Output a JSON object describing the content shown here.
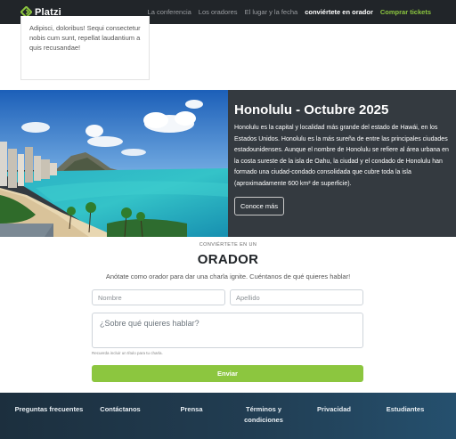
{
  "navbar": {
    "brand": "Platzi",
    "links": [
      {
        "label": "La conferencia"
      },
      {
        "label": "Los oradores"
      },
      {
        "label": "El lugar y la fecha"
      },
      {
        "label": "conviértete en orador"
      },
      {
        "label": "Comprar tickets"
      }
    ]
  },
  "top_card": {
    "text": "Adipisci, doloribus! Sequi consectetur nobis cum sunt, repellat laudantium a quis recusandae!"
  },
  "honolulu": {
    "title": "Honolulu - Octubre 2025",
    "description": "Honolulu es la capital y localidad más grande del estado de Hawái, en los Estados Unidos. Honolulu es la más sureña de entre las principales ciudades estadounidenses. Aunque el nombre de Honolulu se refiere al área urbana en la costa sureste de la isla de Oahu, la ciudad y el condado de Honolulu han formado una ciudad-condado consolidada que cubre toda la isla (aproximadamente 600 km² de superficie).",
    "button": "Conoce más"
  },
  "speaker_form": {
    "kicker": "CONVIÉRTETE EN UN",
    "title": "ORADOR",
    "subtitle": "Anótate como orador para dar una charla ignite. Cuéntanos de qué quieres hablar!",
    "first_name_placeholder": "Nombre",
    "last_name_placeholder": "Apellido",
    "topic_placeholder": "¿Sobre qué quieres hablar?",
    "hint": "Recuerda incluir un título para tu charla.",
    "submit": "Enviar"
  },
  "footer": {
    "items": [
      {
        "label": "Preguntas frecuentes"
      },
      {
        "label": "Contáctanos"
      },
      {
        "label": "Prensa"
      },
      {
        "label": "Términos y condiciones"
      },
      {
        "label": "Privacidad"
      },
      {
        "label": "Estudiantes"
      }
    ]
  },
  "colors": {
    "navbar_bg": "#212529",
    "accent_green": "#8cc63f",
    "section_dark": "#343a40",
    "footer_gradient": [
      "#1c2f3e",
      "#25506e"
    ]
  }
}
